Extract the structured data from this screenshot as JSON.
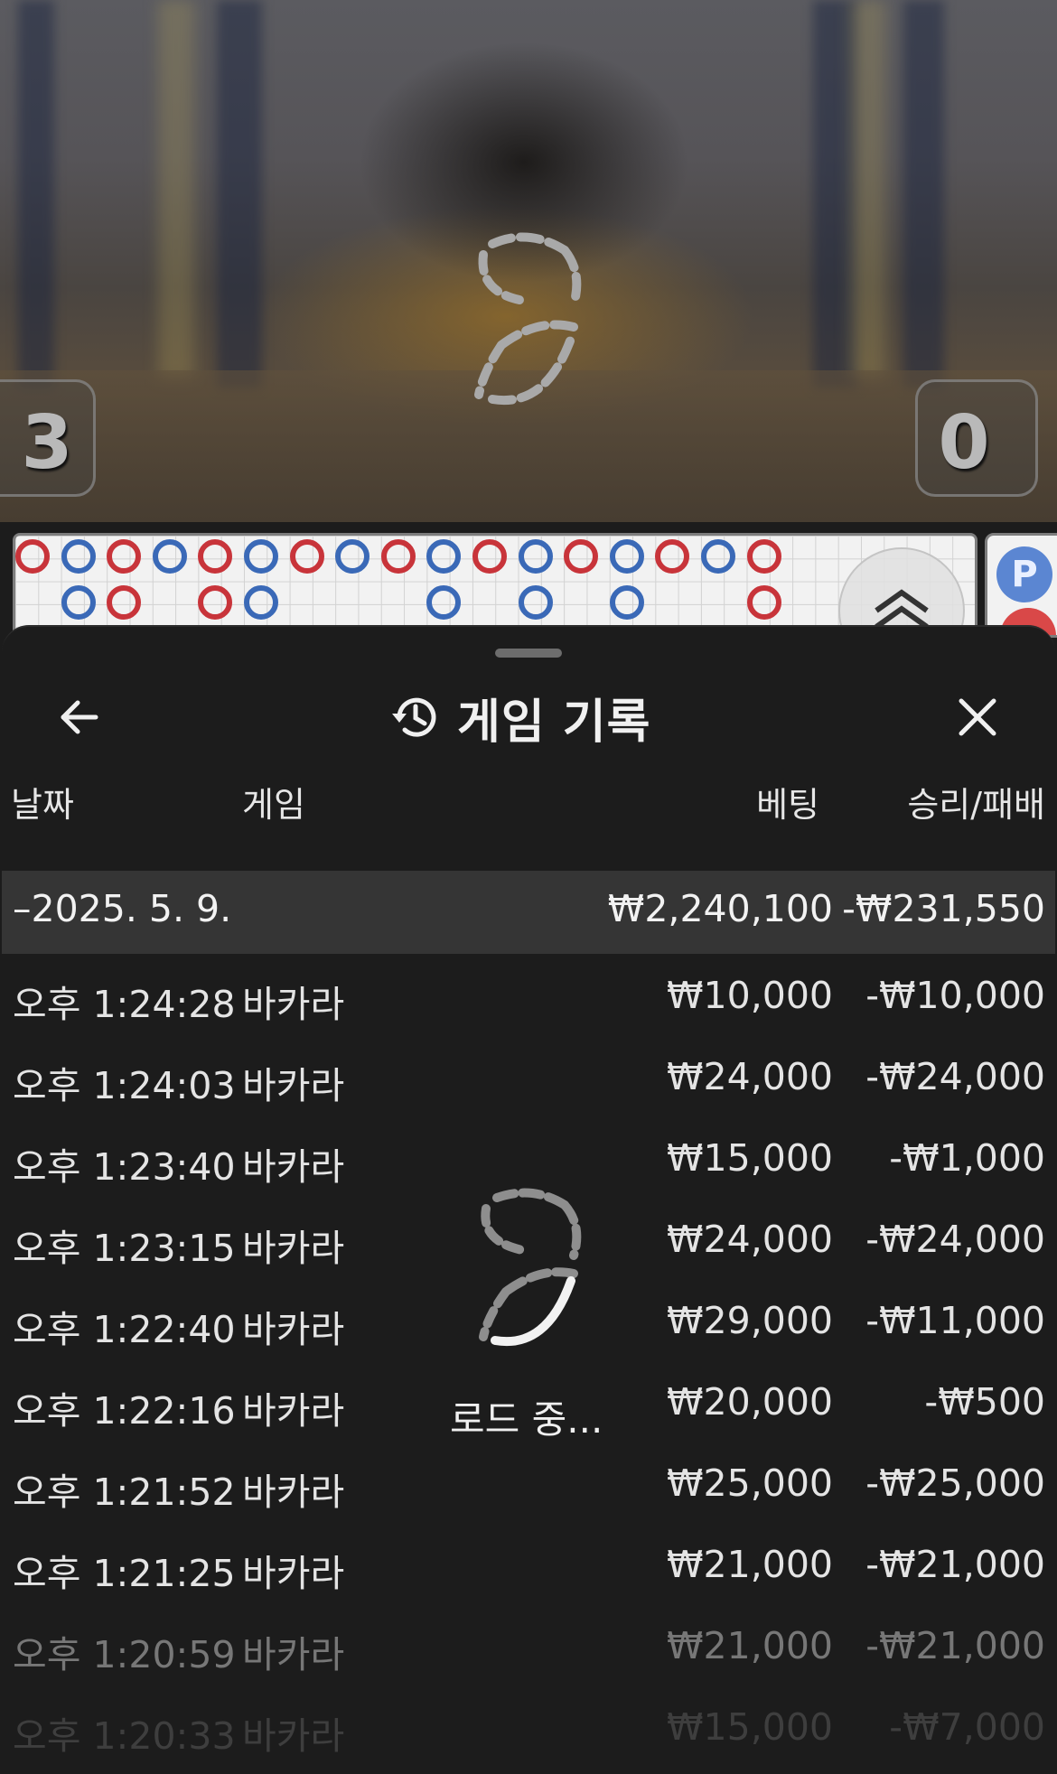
{
  "video": {
    "score_left": "3",
    "score_right": "0"
  },
  "roadmap": {
    "top_row": [
      "B",
      "P",
      "B",
      "P",
      "B",
      "P",
      "B",
      "P",
      "B",
      "P",
      "B",
      "P",
      "B",
      "P",
      "B",
      "P",
      "B"
    ],
    "bottom_row": [
      {
        "col": 1,
        "v": "P"
      },
      {
        "col": 2,
        "v": "B"
      },
      {
        "col": 4,
        "v": "B"
      },
      {
        "col": 5,
        "v": "P"
      },
      {
        "col": 9,
        "v": "P"
      },
      {
        "col": 11,
        "v": "P"
      },
      {
        "col": 13,
        "v": "P"
      },
      {
        "col": 16,
        "v": "B"
      }
    ],
    "side_label": "P"
  },
  "header": {
    "title": "게임 기록",
    "back_icon": "arrow-left-icon",
    "close_icon": "close-icon",
    "history_icon": "history-icon"
  },
  "columns": {
    "date": "날짜",
    "game": "게임",
    "bet": "베팅",
    "result": "승리/패배"
  },
  "summary": {
    "date": "–2025. 5. 9.",
    "bet": "₩2,240,100",
    "result": "-₩231,550"
  },
  "rows": [
    {
      "time": "오후 1:24:28",
      "game": "바카라",
      "bet": "₩10,000",
      "result": "-₩10,000"
    },
    {
      "time": "오후 1:24:03",
      "game": "바카라",
      "bet": "₩24,000",
      "result": "-₩24,000"
    },
    {
      "time": "오후 1:23:40",
      "game": "바카라",
      "bet": "₩15,000",
      "result": "-₩1,000"
    },
    {
      "time": "오후 1:23:15",
      "game": "바카라",
      "bet": "₩24,000",
      "result": "-₩24,000"
    },
    {
      "time": "오후 1:22:40",
      "game": "바카라",
      "bet": "₩29,000",
      "result": "-₩11,000"
    },
    {
      "time": "오후 1:22:16",
      "game": "바카라",
      "bet": "₩20,000",
      "result": "-₩500"
    },
    {
      "time": "오후 1:21:52",
      "game": "바카라",
      "bet": "₩25,000",
      "result": "-₩25,000"
    },
    {
      "time": "오후 1:21:25",
      "game": "바카라",
      "bet": "₩21,000",
      "result": "-₩21,000"
    },
    {
      "time": "오후 1:20:59",
      "game": "바카라",
      "bet": "₩21,000",
      "result": "-₩21,000"
    },
    {
      "time": "오후 1:20:33",
      "game": "바카라",
      "bet": "₩15,000",
      "result": "-₩7,000"
    }
  ],
  "loading_text": "로드 중..."
}
